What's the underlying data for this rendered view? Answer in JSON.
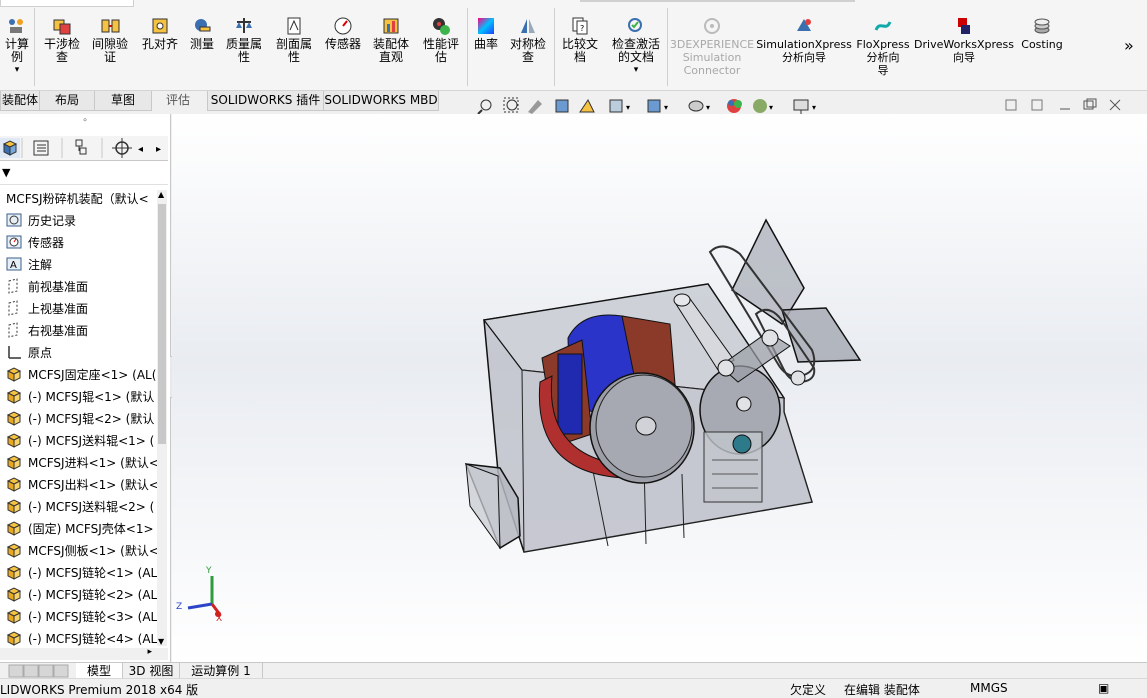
{
  "ribbon": {
    "buttons": [
      {
        "label": "计算\n例",
        "icon": "calculator-icon"
      },
      {
        "label": "干涉检\n查",
        "icon": "interference-icon"
      },
      {
        "label": "间隙验\n证",
        "icon": "clearance-icon"
      },
      {
        "label": "孔对齐",
        "icon": "hole-align-icon"
      },
      {
        "label": "测量",
        "icon": "measure-icon"
      },
      {
        "label": "质量属\n性",
        "icon": "mass-properties-icon"
      },
      {
        "label": "剖面属\n性",
        "icon": "section-properties-icon"
      },
      {
        "label": "传感器",
        "icon": "sensor-icon"
      },
      {
        "label": "装配体\n直观",
        "icon": "assembly-visualization-icon"
      },
      {
        "label": "性能评\n估",
        "icon": "performance-icon"
      },
      {
        "label": "曲率",
        "icon": "curvature-icon"
      },
      {
        "label": "对称检\n查",
        "icon": "symmetry-check-icon"
      },
      {
        "label": "比较文\n档",
        "icon": "compare-documents-icon"
      },
      {
        "label": "检查激活\n的文档",
        "icon": "check-active-document-icon"
      },
      {
        "label": "3DEXPERIENCE\nSimulation\nConnector",
        "icon": "3dexperience-icon",
        "disabled": true
      },
      {
        "label": "SimulationXpress\n分析向导",
        "icon": "simulationxpress-icon"
      },
      {
        "label": "FloXpress\n分析向\n导",
        "icon": "floxpress-icon"
      },
      {
        "label": "DriveWorksXpress\n向导",
        "icon": "driveworksxpress-icon"
      },
      {
        "label": "Costing",
        "icon": "costing-icon"
      }
    ],
    "more": "»"
  },
  "tabs": [
    "装配体",
    "布局",
    "草图",
    "评估",
    "SOLIDWORKS 插件",
    "SOLIDWORKS MBD"
  ],
  "active_tab": "评估",
  "feature_tree": {
    "root": "MCFSJ粉碎机装配（默认< ",
    "items": [
      {
        "label": "历史记录",
        "icon": "history-icon"
      },
      {
        "label": "传感器",
        "icon": "sensor-icon"
      },
      {
        "label": "注解",
        "icon": "annotation-icon"
      },
      {
        "label": "前视基准面",
        "icon": "plane-icon"
      },
      {
        "label": "上视基准面",
        "icon": "plane-icon"
      },
      {
        "label": "右视基准面",
        "icon": "plane-icon"
      },
      {
        "label": "原点",
        "icon": "origin-icon"
      },
      {
        "label": "MCFSJ固定座<1> (AL(",
        "icon": "part-icon"
      },
      {
        "label": "(-) MCFSJ辊<1> (默认",
        "icon": "part-icon"
      },
      {
        "label": "(-) MCFSJ辊<2> (默认",
        "icon": "part-icon"
      },
      {
        "label": "(-) MCFSJ送料辊<1> (",
        "icon": "part-icon"
      },
      {
        "label": "MCFSJ进料<1> (默认<",
        "icon": "part-icon"
      },
      {
        "label": "MCFSJ出料<1> (默认<",
        "icon": "part-icon"
      },
      {
        "label": "(-) MCFSJ送料辊<2> (",
        "icon": "part-icon"
      },
      {
        "label": "(固定) MCFSJ壳体<1>",
        "icon": "part-icon"
      },
      {
        "label": "MCFSJ侧板<1> (默认<",
        "icon": "part-icon"
      },
      {
        "label": "(-) MCFSJ链轮<1> (AL",
        "icon": "part-icon"
      },
      {
        "label": "(-) MCFSJ链轮<2> (AL",
        "icon": "part-icon"
      },
      {
        "label": "(-) MCFSJ链轮<3> (AL",
        "icon": "part-icon"
      },
      {
        "label": "(-) MCFSJ链轮<4> (AL",
        "icon": "part-icon"
      }
    ]
  },
  "bottom_tabs": [
    "模型",
    "3D 视图",
    "运动算例 1"
  ],
  "status": {
    "product": "LIDWORKS Premium 2018 x64 版",
    "defined": "欠定义",
    "editing": "在编辑 装配体",
    "units": "MMGS"
  },
  "triad": {
    "x": "X",
    "y": "Y",
    "z": "Z"
  }
}
